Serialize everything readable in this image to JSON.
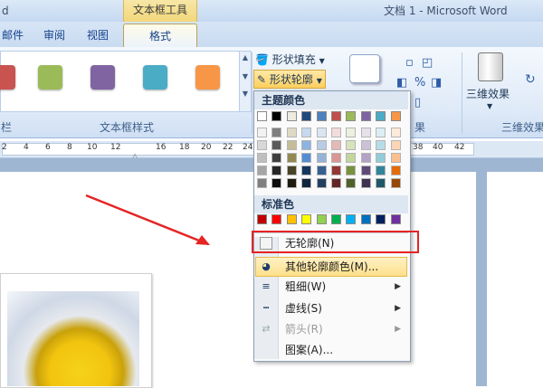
{
  "window": {
    "left_fragment": "d",
    "title": "文档 1 - Microsoft Word",
    "context_group": "文本框工具"
  },
  "tabs": [
    {
      "label": "邮件"
    },
    {
      "label": "审阅"
    },
    {
      "label": "视图"
    },
    {
      "label": "格式",
      "active": true
    }
  ],
  "ribbon": {
    "style_swatches": [
      "#c9534f",
      "#9bbb59",
      "#8064a2",
      "#4bacc6",
      "#f79646"
    ],
    "group_labels": {
      "left_fragment": "栏",
      "textbox_styles": "文本框样式",
      "effects_fragment": "果",
      "three_d": "三维效果"
    },
    "shape_fill": "形状填充",
    "shape_outline": "形状轮廓",
    "shadow_fragment": "阴影效果",
    "three_d_button": "三维效果"
  },
  "ruler": {
    "ticks": [
      "2",
      "4",
      "6",
      "8",
      "10",
      "12",
      "16",
      "18",
      "20",
      "22",
      "24",
      "26",
      "28",
      "38",
      "40",
      "42"
    ]
  },
  "outline_menu": {
    "theme_header": "主题颜色",
    "theme_top": [
      "#ffffff",
      "#000000",
      "#eeece1",
      "#1f497d",
      "#4f81bd",
      "#c0504d",
      "#9bbb59",
      "#8064a2",
      "#4bacc6",
      "#f79646"
    ],
    "theme_shades": [
      [
        "#f2f2f2",
        "#7f7f7f",
        "#ddd9c3",
        "#c6d9f0",
        "#dbe5f1",
        "#f2dcdb",
        "#ebf1dd",
        "#e5e0ec",
        "#dbeef3",
        "#fdeada"
      ],
      [
        "#d8d8d8",
        "#595959",
        "#c4bd97",
        "#8db3e2",
        "#b8cce4",
        "#e5b9b7",
        "#d7e3bc",
        "#ccc1d9",
        "#b7dde8",
        "#fbd5b5"
      ],
      [
        "#bfbfbf",
        "#3f3f3f",
        "#938953",
        "#548dd4",
        "#95b3d7",
        "#d99694",
        "#c3d69b",
        "#b2a2c7",
        "#92cddc",
        "#fac08f"
      ],
      [
        "#a5a5a5",
        "#262626",
        "#494429",
        "#17365d",
        "#366092",
        "#953734",
        "#76923c",
        "#5f497a",
        "#31859b",
        "#e36c09"
      ],
      [
        "#7f7f7f",
        "#0c0c0c",
        "#1d1b10",
        "#0f243e",
        "#244061",
        "#632423",
        "#4f6128",
        "#3f3151",
        "#205867",
        "#974806"
      ]
    ],
    "standard_header": "标准色",
    "standard_colors": [
      "#c00000",
      "#ff0000",
      "#ffc000",
      "#ffff00",
      "#92d050",
      "#00b050",
      "#00b0f0",
      "#0070c0",
      "#002060",
      "#7030a0"
    ],
    "items": [
      {
        "label": "无轮廓(N)",
        "icon": "empty-square-icon"
      },
      {
        "label": "其他轮廓颜色(M)...",
        "icon": "palette-icon",
        "highlighted": true
      },
      {
        "label": "粗细(W)",
        "icon": "line-weight-icon",
        "submenu": true
      },
      {
        "label": "虚线(S)",
        "icon": "dash-line-icon",
        "submenu": true
      },
      {
        "label": "箭头(R)",
        "icon": "arrow-style-icon",
        "submenu": true,
        "disabled": true
      },
      {
        "label": "图案(A)...",
        "icon": "pattern-icon"
      }
    ]
  },
  "annotation": {
    "arrow_color": "#e52424",
    "box_color": "#e52424"
  }
}
